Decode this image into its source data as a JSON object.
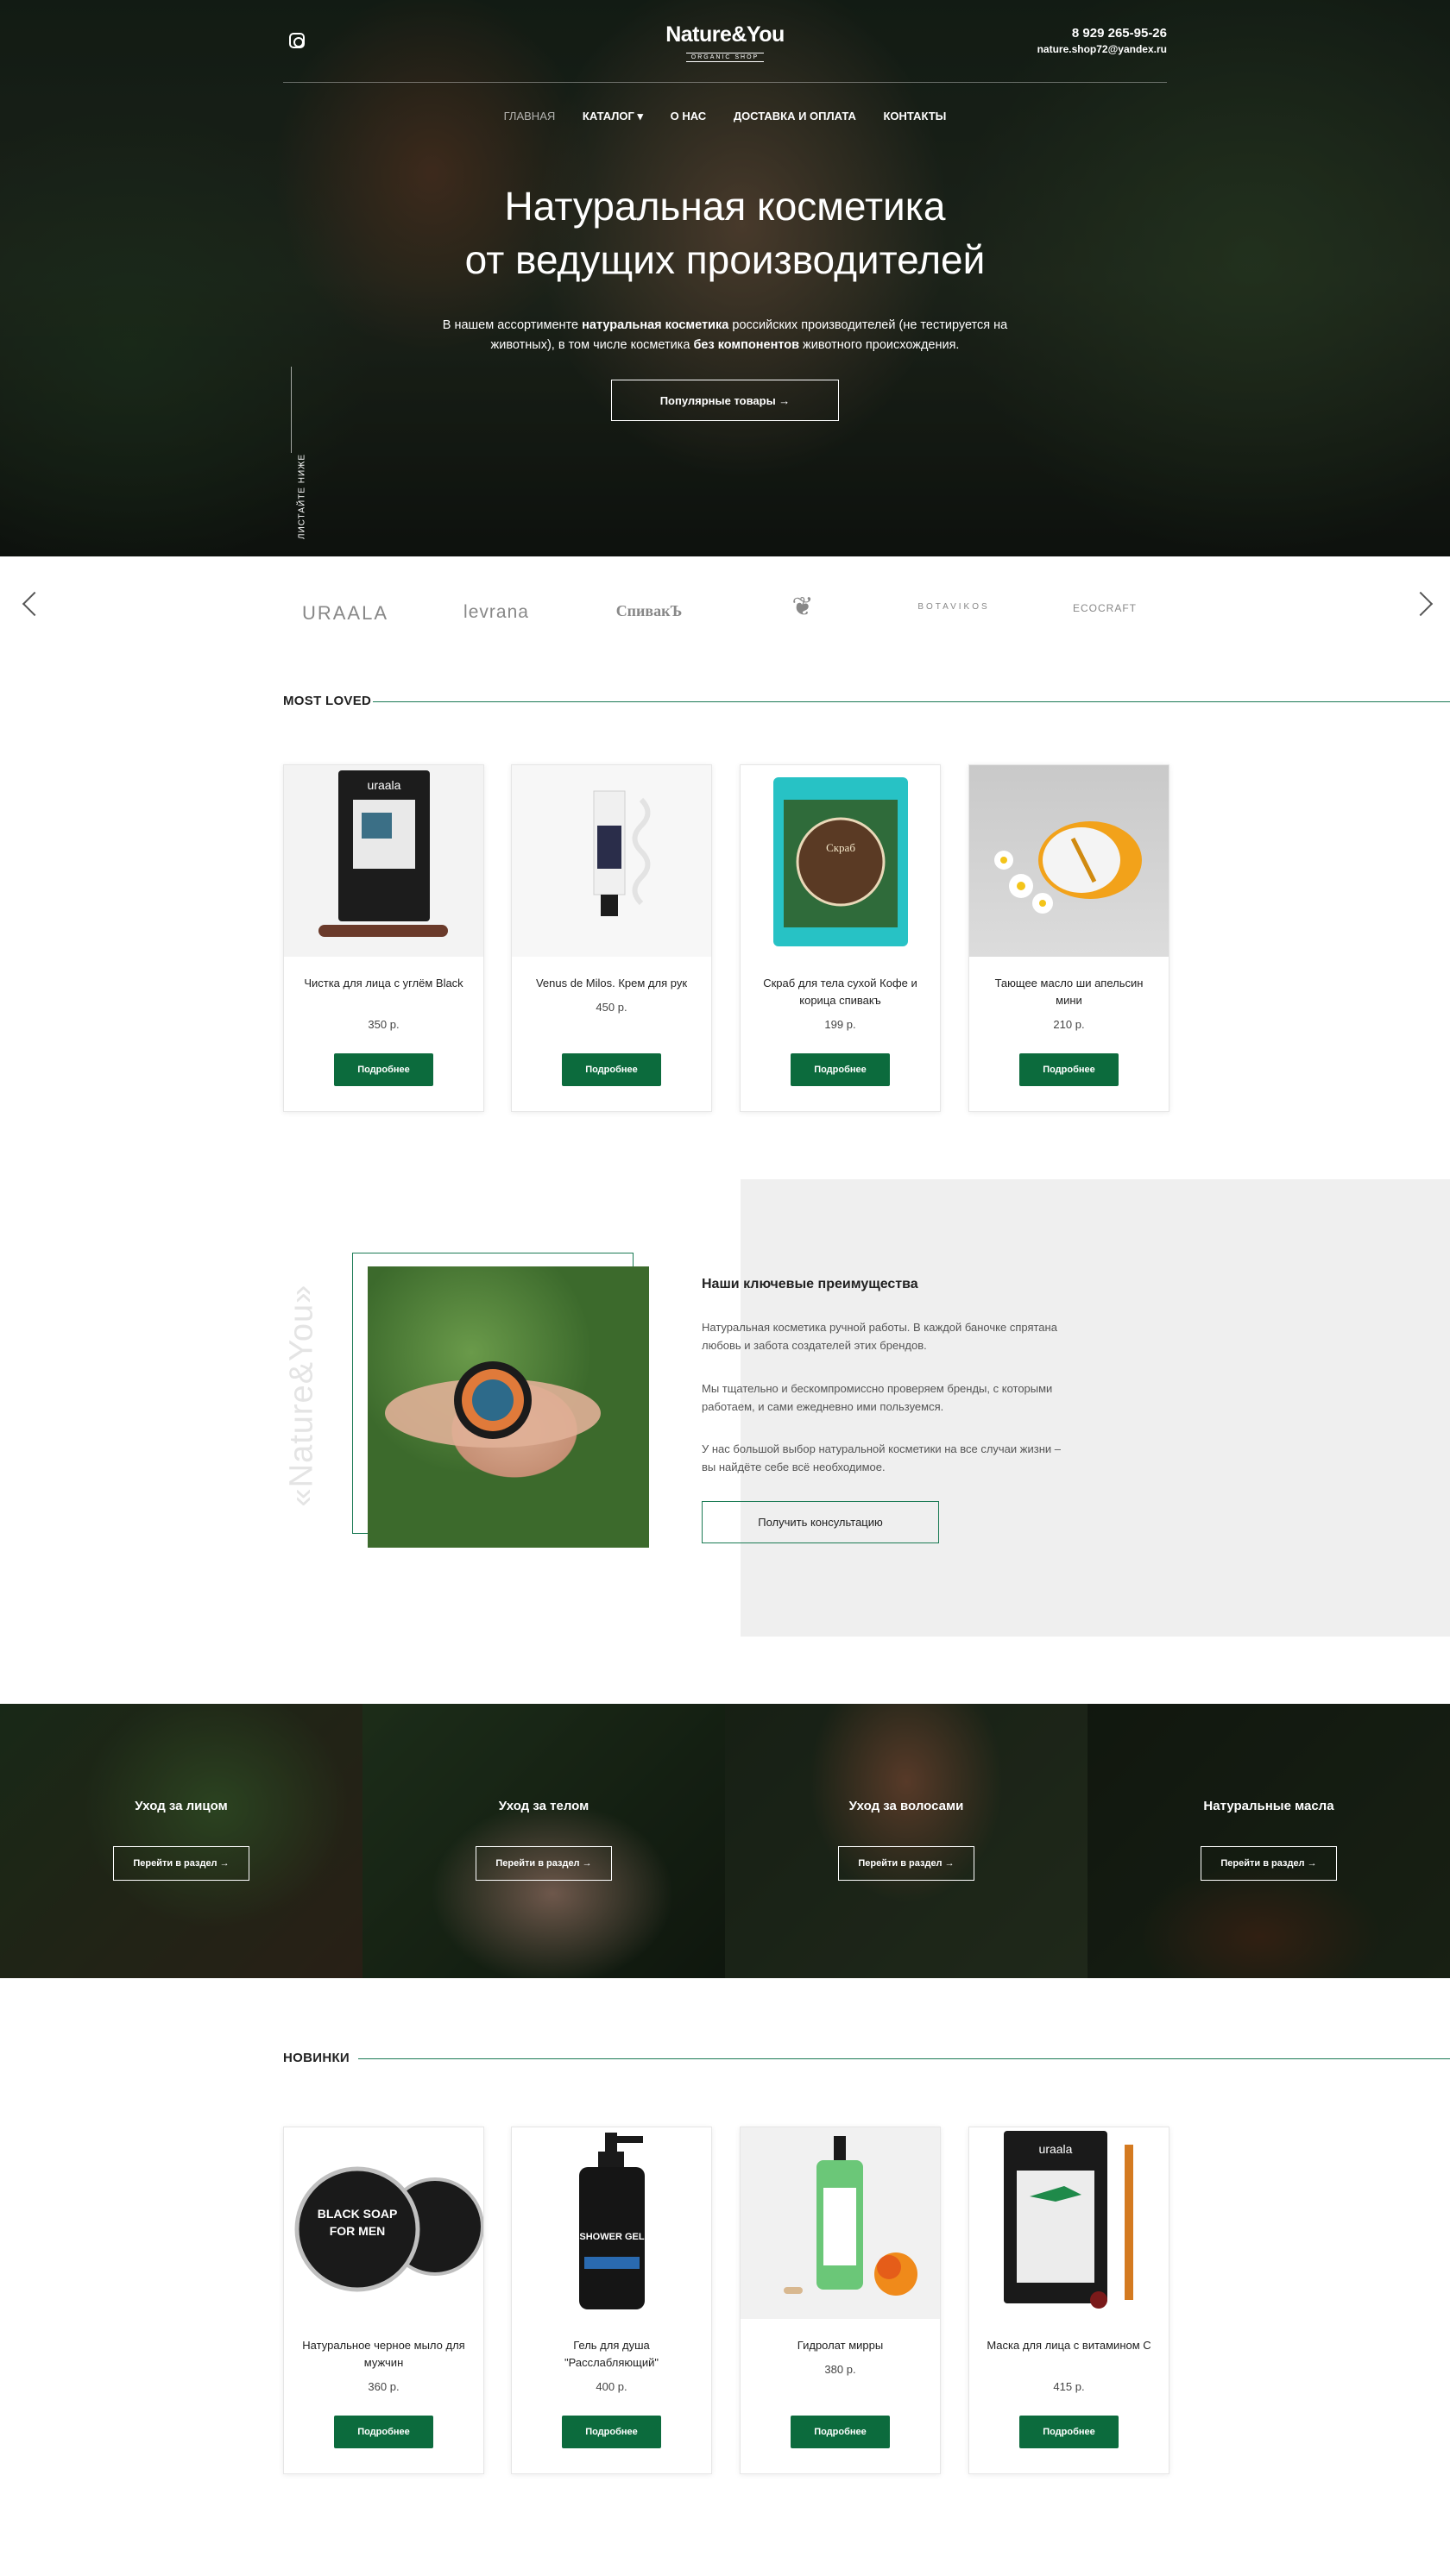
{
  "header": {
    "logo_main": "Nature&You",
    "logo_sub": "ORGANIC SHOP",
    "phone": "8 929 265-95-26",
    "email": "nature.shop72@yandex.ru",
    "instagram_icon": "instagram-icon"
  },
  "nav": {
    "items": [
      "ГЛАВНАЯ",
      "КАТАЛОГ ▾",
      "О НАС",
      "ДОСТАВКА И ОПЛАТА",
      "КОНТАКТЫ"
    ],
    "active": "ГЛАВНАЯ"
  },
  "hero": {
    "title_line1": "Натуральная косметика",
    "title_line2": "от ведущих производителей",
    "text_a": "В нашем ассортименте ",
    "text_b": "натуральная косметика",
    "text_c": " российских производителей (не тестируется на животных), в том числе косметика ",
    "text_d": "без компонентов",
    "text_e": " животного происхождения.",
    "button": "Популярные товары →",
    "scroll_hint": "ЛИСТАЙТЕ НИЖЕ"
  },
  "brands": [
    "URAALA",
    "levrana",
    "СпивакЪ",
    "❦",
    "BOTAVIKOS",
    "ECOCRAFT"
  ],
  "most_loved": {
    "title": "MOST LOVED",
    "products": [
      {
        "name": "Чистка для лица с углём Black",
        "price": "350 р.",
        "button": "Подробнее"
      },
      {
        "name": "Venus de Milos. Крем для рук",
        "price": "450 р.",
        "button": "Подробнее"
      },
      {
        "name": "Скраб для тела сухой Кофе и корица спивакъ",
        "price": "199 р.",
        "button": "Подробнее"
      },
      {
        "name": "Тающее масло ши апельсин мини",
        "price": "210 р.",
        "button": "Подробнее"
      }
    ]
  },
  "advantages": {
    "vertical_text": "«Nature&You»",
    "title": "Наши ключевые преимущества",
    "p1": "Натуральная косметика ручной работы. В каждой баночке спрятана любовь и забота создателей этих брендов.",
    "p2": "Мы тщательно и бескомпромиссно проверяем бренды, с которыми работаем, и сами ежедневно ими пользуемся.",
    "p3": "У нас большой выбор натуральной косметики на все случаи жизни – вы найдёте себе всё необходимое.",
    "button": "Получить консультацию"
  },
  "categories": [
    {
      "title": "Уход за лицом",
      "button": "Перейти в раздел →"
    },
    {
      "title": "Уход за телом",
      "button": "Перейти в раздел →"
    },
    {
      "title": "Уход за волосами",
      "button": "Перейти в раздел →"
    },
    {
      "title": "Натуральные масла",
      "button": "Перейти в раздел →"
    }
  ],
  "new_items": {
    "title": "НОВИНКИ",
    "products": [
      {
        "name": "Натуральное черное мыло для мужчин",
        "price": "360 р.",
        "button": "Подробнее"
      },
      {
        "name": "Гель для душа \"Расслабляющий\"",
        "price": "400 р.",
        "button": "Подробнее"
      },
      {
        "name": "Гидролат мирры",
        "price": "380 р.",
        "button": "Подробнее"
      },
      {
        "name": "Маска для лица с витамином С",
        "price": "415 р.",
        "button": "Подробнее"
      }
    ]
  },
  "colors": {
    "accent": "#0c6b3d",
    "line": "#1a7a54",
    "panel": "#efefef"
  }
}
